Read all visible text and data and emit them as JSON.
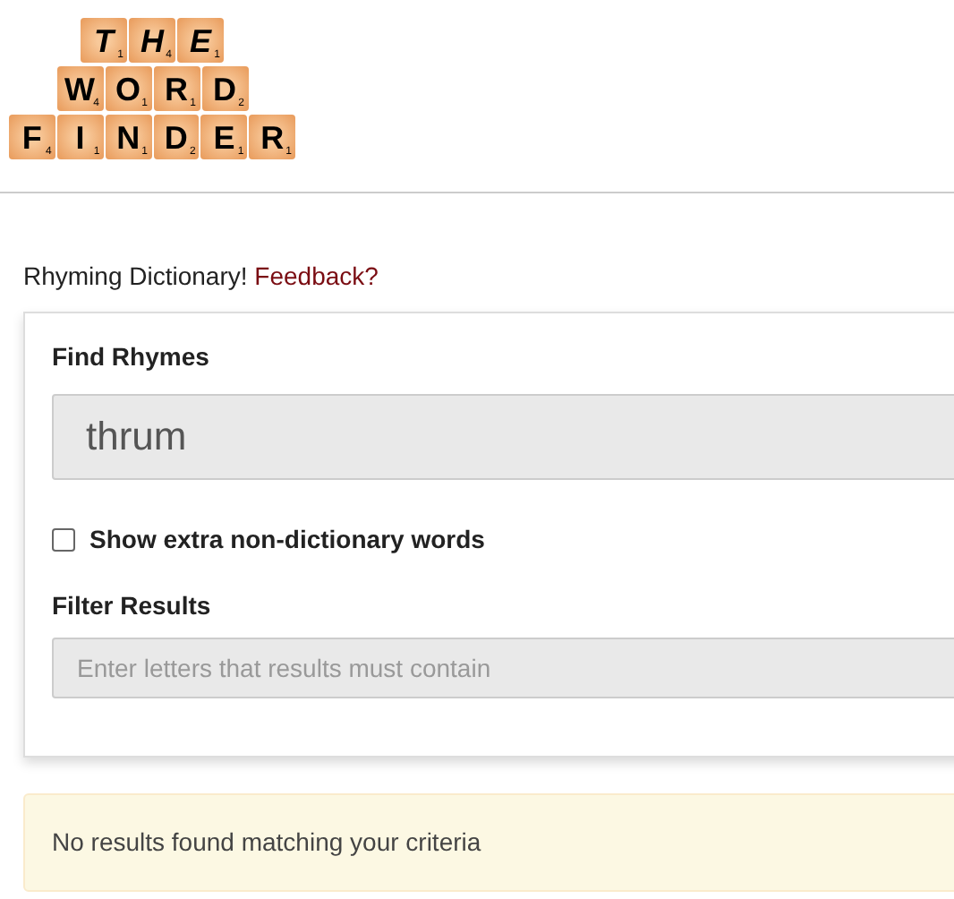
{
  "logo": {
    "lines": [
      {
        "tiles": [
          {
            "letter": "T",
            "score": "1"
          },
          {
            "letter": "H",
            "score": "4"
          },
          {
            "letter": "E",
            "score": "1"
          }
        ]
      },
      {
        "tiles": [
          {
            "letter": "W",
            "score": "4"
          },
          {
            "letter": "O",
            "score": "1"
          },
          {
            "letter": "R",
            "score": "1"
          },
          {
            "letter": "D",
            "score": "2"
          }
        ]
      },
      {
        "tiles": [
          {
            "letter": "F",
            "score": "4"
          },
          {
            "letter": "I",
            "score": "1"
          },
          {
            "letter": "N",
            "score": "1"
          },
          {
            "letter": "D",
            "score": "2"
          },
          {
            "letter": "E",
            "score": "1"
          },
          {
            "letter": "R",
            "score": "1"
          }
        ]
      }
    ]
  },
  "intro": {
    "text": "Rhyming Dictionary!",
    "link": "Feedback?"
  },
  "form": {
    "find_label": "Find Rhymes",
    "find_value": "thrum",
    "extra_words": {
      "label": "Show extra non-dictionary words",
      "checked": false
    },
    "filter_label": "Filter Results",
    "filter_placeholder": "Enter letters that results must contain"
  },
  "alert": "No results found matching your criteria"
}
